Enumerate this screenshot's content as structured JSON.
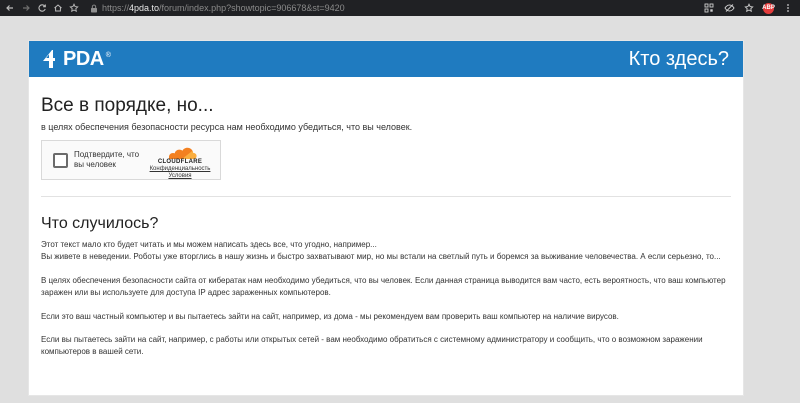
{
  "browser": {
    "url_prefix": "https://",
    "url_host": "4pda.to",
    "url_path": "/forum/index.php?showtopic=906678&st=9420",
    "back_icon": "back-arrow-icon",
    "forward_icon": "forward-arrow-icon",
    "reload_icon": "reload-icon",
    "home_icon": "home-icon",
    "bookmark_icon": "star-icon",
    "ext_badge_text": "ABP"
  },
  "header": {
    "logo_text": "PDA",
    "logo_reg": "®",
    "title": "Кто здесь?",
    "color": "#1f7bc0"
  },
  "main": {
    "heading": "Все в порядке, но...",
    "subtitle": "в целях обеспечения безопасности ресурса нам необходимо убедиться, что вы человек."
  },
  "captcha": {
    "label": "Подтвердите, что вы человек",
    "brand": "CLOUDFLARE",
    "privacy_link": "Конфиденциальность",
    "terms_link": "Условия"
  },
  "section": {
    "heading": "Что случилось?",
    "paragraphs": [
      "Этот текст мало кто будет читать и мы можем написать здесь все, что угодно, например... Вы живете в неведении. Роботы уже вторглись в нашу жизнь и быстро захватывают мир, но мы встали на светлый путь и боремся за выживание человечества. А если серьезно, то...",
      "В целях обеспечения безопасности сайта от кибератак нам необходимо убедиться, что вы человек. Если данная страница выводится вам часто, есть вероятность, что ваш компьютер заражен или вы используете для доступа IP адрес зараженных компьютеров.",
      "Если это ваш частный компьютер и вы пытаетесь зайти на сайт, например, из дома - мы рекомендуем вам проверить ваш компьютер на наличие вирусов.",
      "Если вы пытаетесь зайти на сайт, например, с работы или открытых сетей - вам необходимо обратиться с системному администратору и сообщить, что о возможном заражении компьютеров в вашей сети."
    ],
    "line1": "Этот текст мало кто будет читать и мы можем написать здесь все, что угодно, например...",
    "line2": "Вы живете в неведении. Роботы уже вторглись в нашу жизнь и быстро захватывают мир, но мы встали на светлый путь и боремся за выживание человечества. А если серьезно, то..."
  }
}
